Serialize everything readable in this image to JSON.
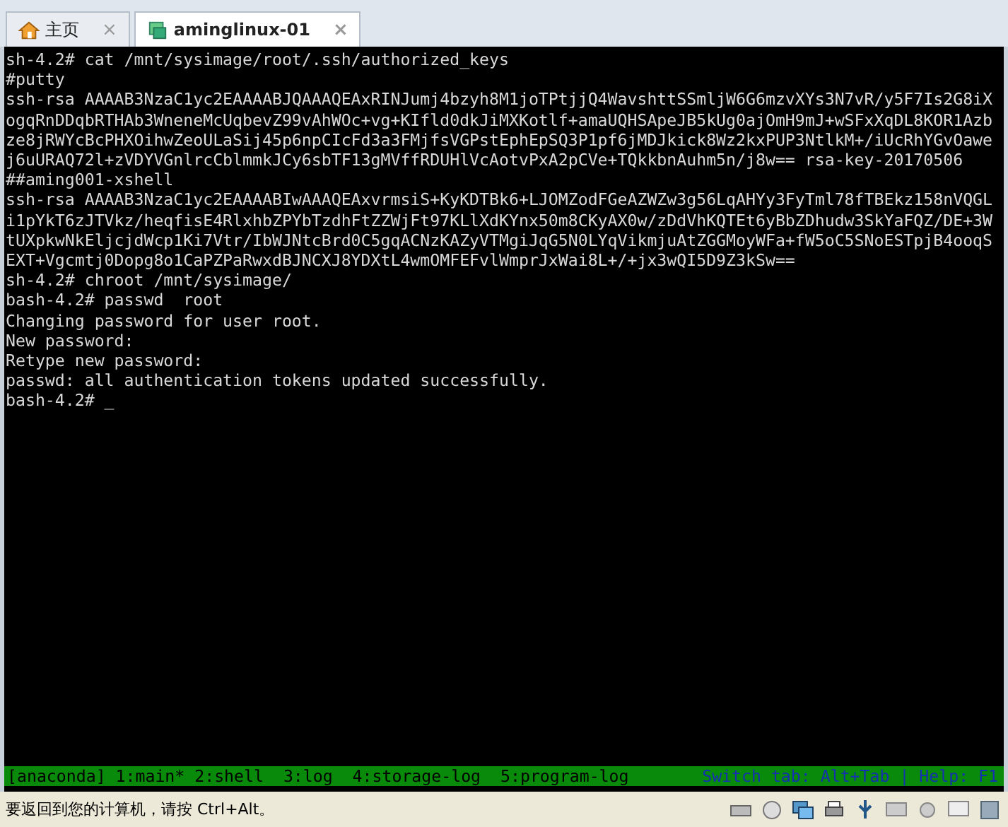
{
  "tabs": [
    {
      "label": "主页",
      "selected": false,
      "close": "×"
    },
    {
      "label": "aminglinux-01",
      "selected": true,
      "close": "×"
    }
  ],
  "terminal": {
    "lines": [
      "sh-4.2# cat /mnt/sysimage/root/.ssh/authorized_keys",
      "#putty",
      "ssh-rsa AAAAB3NzaC1yc2EAAAABJQAAAQEAxRINJumj4bzyh8M1joTPtjjQ4WavshttSSmljW6G6mzvXYs3N7vR/y5F7Is2G8iX",
      "ogqRnDDqbRTHAb3WneneMcUqbevZ99vAhWOc+vg+KIfld0dkJiMXKotlf+amaUQHSApeJB5kUg0ajOmH9mJ+wSFxXqDL8KOR1Azb",
      "ze8jRWYcBcPHXOihwZeoULaSij45p6npCIcFd3a3FMjfsVGPstEphEpSQ3P1pf6jMDJkick8Wz2kxPUP3NtlkM+/iUcRhYGvOawe",
      "j6uURAQ72l+zVDYVGnlrcCblmmkJCy6sbTF13gMVffRDUHlVcAotvPxA2pCVe+TQkkbnAuhm5n/j8w== rsa-key-20170506",
      "##aming001-xshell",
      "ssh-rsa AAAAB3NzaC1yc2EAAAABIwAAAQEAxvrmsiS+KyKDTBk6+LJOMZodFGeAZWZw3g56LqAHYy3FyTml78fTBEkz158nVQGL",
      "i1pYkT6zJTVkz/heqfisE4RlxhbZPYbTzdhFtZZWjFt97KLlXdKYnx50m8CKyAX0w/zDdVhKQTEt6yBbZDhudw3SkYaFQZ/DE+3W",
      "tUXpkwNkEljcjdWcp1Ki7Vtr/IbWJNtcBrd0C5gqACNzKAZyVTMgiJqG5N0LYqVikmjuAtZGGMoyWFa+fW5oC5SNoESTpjB4ooqS",
      "EXT+Vgcmtj0Dopg8o1CaPZPaRwxdBJNCXJ8YDXtL4wmOMFEFvlWmprJxWai8L+/+jx3wQI5D9Z3kSw==",
      "sh-4.2# chroot /mnt/sysimage/",
      "bash-4.2# passwd  root",
      "Changing password for user root.",
      "New password:",
      "Retype new password:",
      "passwd: all authentication tokens updated successfully.",
      "bash-4.2# _"
    ],
    "status_bar": {
      "windows": "[anaconda] 1:main* 2:shell  3:log  4:storage-log  5:program-log",
      "hint": "Switch tab: Alt+Tab | Help: F1"
    }
  },
  "vm_status": {
    "message": "要返回到您的计算机，请按 Ctrl+Alt。"
  }
}
